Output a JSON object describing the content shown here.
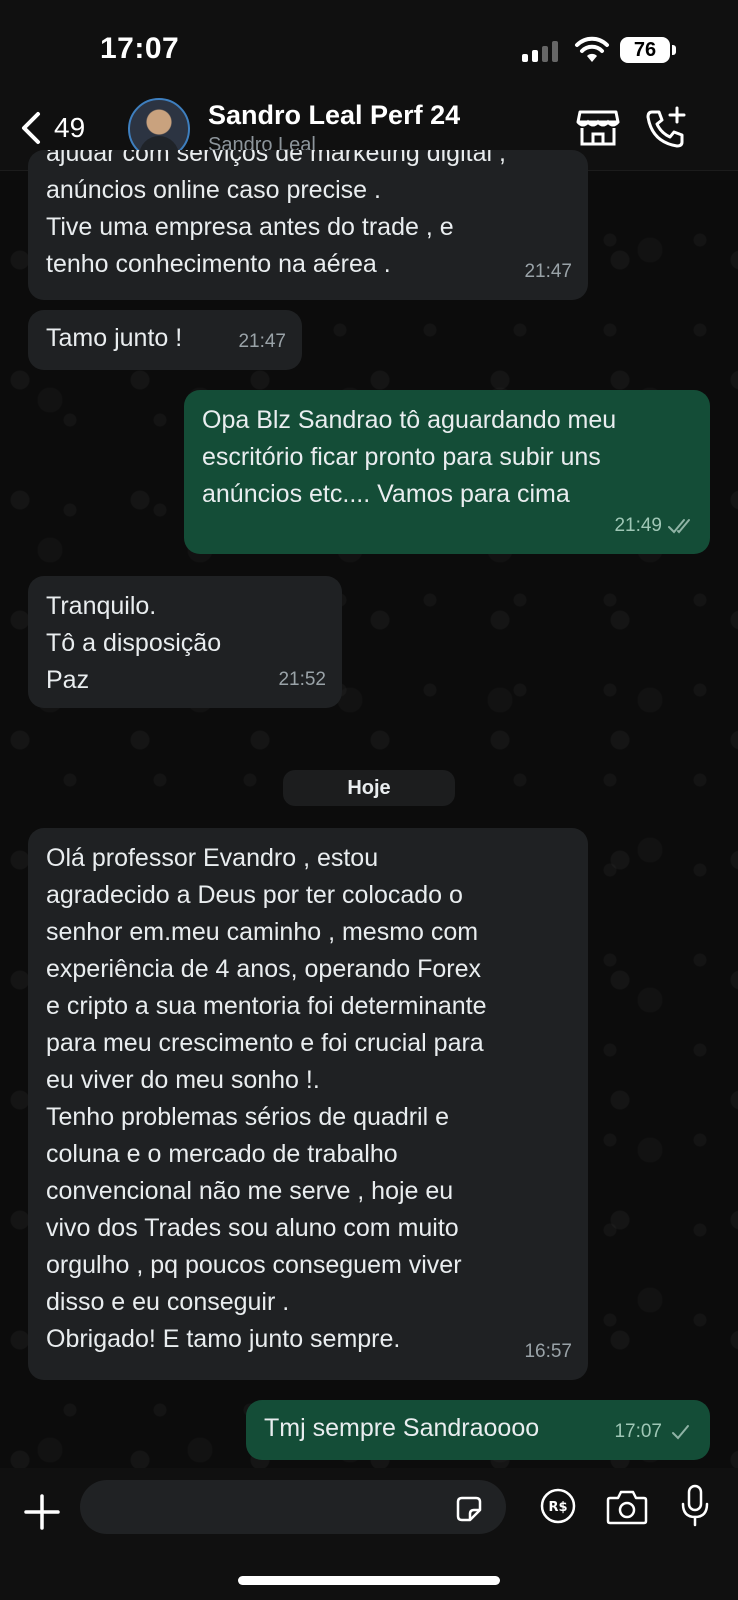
{
  "status_bar": {
    "time": "17:07",
    "battery": "76"
  },
  "header": {
    "back_count": "49",
    "contact_name": "Sandro Leal Perf 24",
    "contact_subtitle": "Sandro Leal"
  },
  "messages": [
    {
      "direction": "in",
      "text": "ajudar com serviços de marketing digital ,\nanúncios online caso precise .\nTive uma empresa antes do trade , e\ntenho conhecimento na aérea .",
      "time": "21:47"
    },
    {
      "direction": "in",
      "text": "Tamo junto !",
      "time": "21:47"
    },
    {
      "direction": "out",
      "text": "Opa Blz Sandrao tô aguardando meu\nescritório ficar pronto para subir uns\nanúncios etc.... Vamos para cima",
      "time": "21:49",
      "ticks": "double"
    },
    {
      "direction": "in",
      "text": "Tranquilo.\nTô a disposição\nPaz",
      "time": "21:52"
    },
    {
      "direction": "in",
      "text": "Olá professor Evandro , estou\nagradecido a Deus por ter colocado o\nsenhor em.meu caminho , mesmo com\nexperiência de 4 anos, operando Forex\ne cripto a sua mentoria foi determinante\npara meu crescimento e foi crucial para\neu viver do meu sonho !.\nTenho problemas sérios de quadril e\ncoluna e o mercado de trabalho\nconvencional não me serve , hoje eu\nvivo dos Trades sou aluno com muito\norgulho , pq poucos conseguem viver\ndisso e eu conseguir .\nObrigado! E tamo junto sempre.",
      "time": "16:57"
    },
    {
      "direction": "out",
      "text": "Tmj sempre Sandraoooo",
      "time": "17:07",
      "ticks": "single"
    }
  ],
  "date_separator": "Hoje",
  "composer": {
    "placeholder": ""
  },
  "icons": {
    "back": "chevron-left-icon",
    "store": "store-icon",
    "call": "add-call-icon",
    "plus": "plus-icon",
    "sticker": "sticker-icon",
    "payment": "currency-real-icon",
    "camera": "camera-icon",
    "mic": "microphone-icon"
  },
  "colors": {
    "incoming_bubble": "#1f2123",
    "outgoing_bubble": "#144d37",
    "background": "#0c0c0c"
  }
}
